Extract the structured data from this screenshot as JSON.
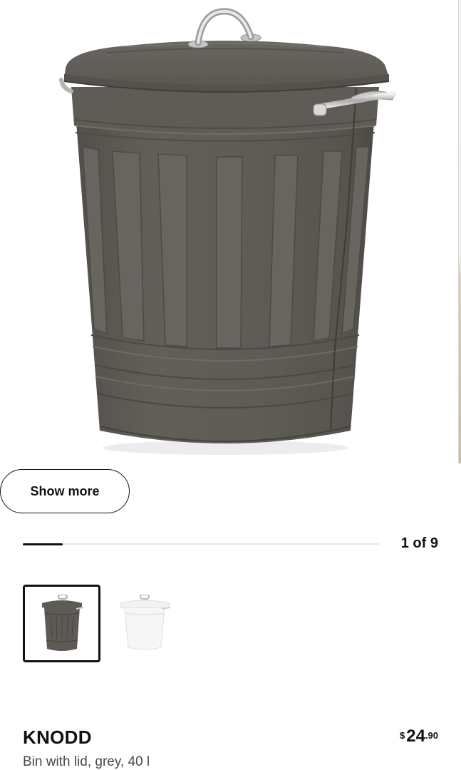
{
  "gallery": {
    "main_image": {
      "subject": "grey bin with lid",
      "icon": "trash-bin-image"
    },
    "show_more_label": "Show more",
    "progress": {
      "current": 1,
      "total": 9,
      "fraction": 0.111
    },
    "slide_counter": "1 of 9"
  },
  "thumbnails": [
    {
      "name": "grey",
      "selected": true,
      "color": "#5e5b56"
    },
    {
      "name": "white",
      "selected": false,
      "color": "#f4f4f4"
    }
  ],
  "product": {
    "name": "KNODD",
    "description": "Bin with lid, grey, 40 l",
    "price": {
      "currency": "$",
      "integer": "24",
      "decimal": ".90"
    }
  },
  "colors": {
    "bin_grey": "#5e5b56",
    "text_primary": "#111111",
    "text_secondary": "#484848"
  }
}
